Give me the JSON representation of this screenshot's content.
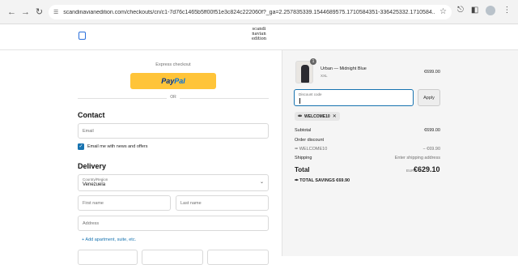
{
  "browser": {
    "url": "scandinavianedition.com/checkouts/cn/c1-7d76c1465b5ff00f51e3c824c222060f?_ga=2.257835339.1544689575.1710584351-336425332.1710584..."
  },
  "header": {
    "logo_text": "scandi navian edition"
  },
  "express": {
    "label": "Express checkout",
    "paypal_pay": "Pay",
    "paypal_pal": "Pal",
    "or": "OR"
  },
  "contact": {
    "heading": "Contact",
    "email_placeholder": "Email",
    "newsletter_label": "Email me with news and offers",
    "newsletter_checked": true
  },
  "delivery": {
    "heading": "Delivery",
    "country_label": "Country/Region",
    "country_value": "Venezuela",
    "first_name_placeholder": "First name",
    "last_name_placeholder": "Last name",
    "address_placeholder": "Address",
    "add_line": "+ Add apartment, suite, etc."
  },
  "summary": {
    "product": {
      "name": "Urban — Midnight Blue",
      "variant": "XXL",
      "quantity": "1",
      "price": "€699.00"
    },
    "discount_label": "Discount code",
    "apply_label": "Apply",
    "applied_code": "WELCOME10",
    "subtotal_label": "Subtotal",
    "subtotal_value": "€699.00",
    "order_discount_label": "Order discount",
    "discount_code_row": "WELCOME10",
    "discount_value": "− €69.90",
    "shipping_label": "Shipping",
    "shipping_value": "Enter shipping address",
    "total_label": "Total",
    "total_currency": "EUR",
    "total_value": "€629.10",
    "savings_label": "TOTAL SAVINGS",
    "savings_value": "€69.90"
  }
}
